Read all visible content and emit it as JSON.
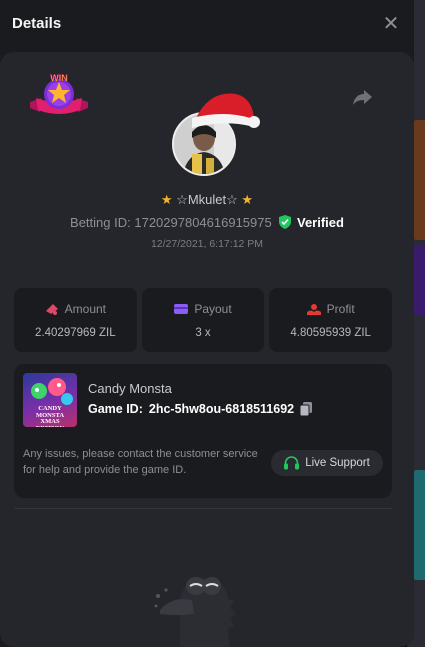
{
  "modal": {
    "title": "Details"
  },
  "player": {
    "username": "☆Mkulet☆",
    "betting_id_label": "Betting ID:",
    "betting_id": "1720297804616915975",
    "verified": "Verified",
    "timestamp": "12/27/2021, 6:17:12 PM"
  },
  "win_badge": "WIN",
  "stats": {
    "amount": {
      "label": "Amount",
      "value": "2.40297969 ZIL"
    },
    "payout": {
      "label": "Payout",
      "value": "3 x"
    },
    "profit": {
      "label": "Profit",
      "value": "4.80595939 ZIL"
    }
  },
  "game": {
    "thumb_text": "CANDY MONSTA XMAS EDITION",
    "name": "Candy Monsta",
    "id_label": "Game ID:",
    "id": "2hc-5hw8ou-6818511692",
    "issues_text": "Any issues, please contact the customer service for help and provide the game ID.",
    "support_label": "Live Support"
  },
  "colors": {
    "accent_green": "#22c55e",
    "star": "#f5b52a",
    "amount_pink": "#e0476b",
    "payout_purple": "#8b5cf6",
    "profit_red": "#e53935"
  }
}
